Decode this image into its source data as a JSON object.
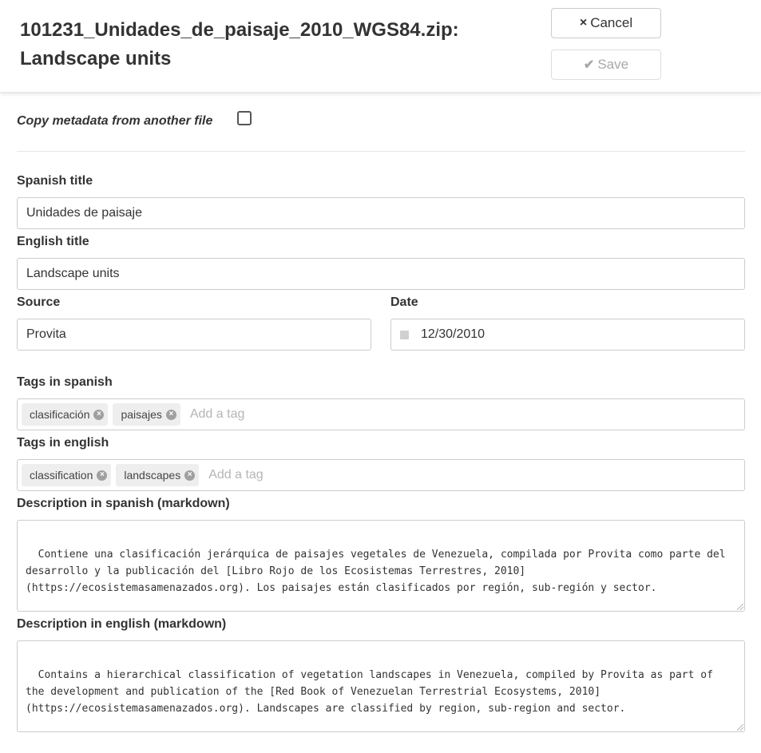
{
  "header": {
    "title": "101231_Unidades_de_paisaje_2010_WGS84.zip: Landscape units",
    "cancel_label": "Cancel",
    "save_label": "Save",
    "cancel_icon": "×",
    "save_icon": "✔"
  },
  "copy_metadata": {
    "label": "Copy metadata from another file",
    "checked": false
  },
  "fields": {
    "spanish_title": {
      "label": "Spanish title",
      "value": "Unidades de paisaje"
    },
    "english_title": {
      "label": "English title",
      "value": "Landscape units"
    },
    "source": {
      "label": "Source",
      "value": "Provita"
    },
    "date": {
      "label": "Date",
      "value": "12/30/2010"
    },
    "tags_spanish": {
      "label": "Tags in spanish",
      "tags": [
        "clasificación",
        "paisajes"
      ],
      "placeholder": "Add a tag"
    },
    "tags_english": {
      "label": "Tags in english",
      "tags": [
        "classification",
        "landscapes"
      ],
      "placeholder": "Add a tag"
    },
    "desc_spanish": {
      "label": "Description in spanish (markdown)",
      "value": "Contiene una clasificación jerárquica de paisajes vegetales de Venezuela, compilada por Provita como parte del desarrollo y la publicación del [Libro Rojo de los Ecosistemas Terrestres, 2010](https://ecosistemasamenazados.org). Los paisajes están clasificados por región, sub-región y sector.\n\nPara mayor información, se puede consultar el Libro Rojo de los Ecosistemas Terrestres de Venezuela,"
    },
    "desc_english": {
      "label": "Description in english (markdown)",
      "value": "Contains a hierarchical classification of vegetation landscapes in Venezuela, compiled by Provita as part of the development and publication of the [Red Book of Venezuelan Terrestrial Ecosystems, 2010](https://ecosistemasamenazados.org). Landscapes are classified by region, sub-region and sector.\n\nFor additional information, see the Red Book of Venezuelan Terrestrial Ecosystems, 2010, [Landscape"
    }
  }
}
